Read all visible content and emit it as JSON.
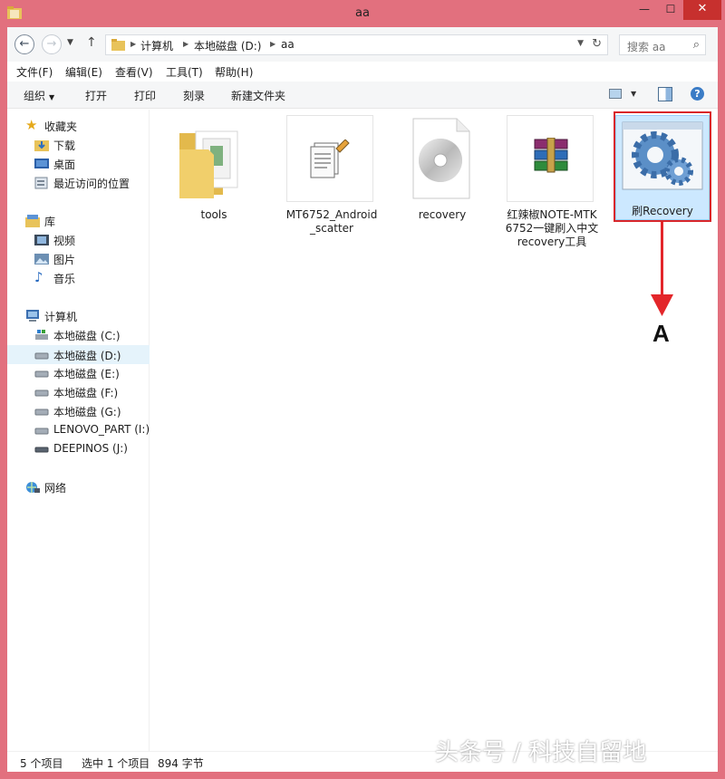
{
  "window": {
    "title": "aa",
    "close_glyph": "✕",
    "min_glyph": "—",
    "max_glyph": "☐"
  },
  "nav": {
    "back_glyph": "←",
    "forward_glyph": "→",
    "up_glyph": "↑",
    "breadcrumbs": [
      "计算机",
      "本地磁盘 (D:)",
      "aa"
    ],
    "search_placeholder": "搜索 aa"
  },
  "menu": [
    "文件(F)",
    "编辑(E)",
    "查看(V)",
    "工具(T)",
    "帮助(H)"
  ],
  "toolbar": {
    "organize": "组织",
    "open": "打开",
    "print": "打印",
    "burn": "刻录",
    "new_folder": "新建文件夹"
  },
  "sidebar": {
    "favorites": {
      "label": "收藏夹",
      "items": [
        "下载",
        "桌面",
        "最近访问的位置"
      ]
    },
    "libraries": {
      "label": "库",
      "items": [
        "视频",
        "图片",
        "音乐"
      ]
    },
    "computer": {
      "label": "计算机",
      "items": [
        "本地磁盘 (C:)",
        "本地磁盘 (D:)",
        "本地磁盘 (E:)",
        "本地磁盘 (F:)",
        "本地磁盘 (G:)",
        "LENOVO_PART (I:)",
        "DEEPINOS (J:)"
      ]
    },
    "network": {
      "label": "网络"
    }
  },
  "files": [
    {
      "name": "tools",
      "icon": "folder-icon"
    },
    {
      "name": "MT6752_Android_scatter",
      "icon": "text-document-icon"
    },
    {
      "name": "recovery",
      "icon": "disc-image-icon"
    },
    {
      "name": "红辣椒NOTE-MTK6752一键刷入中文recovery工具",
      "icon": "winrar-archive-icon"
    },
    {
      "name": "刷Recovery",
      "icon": "gears-batch-icon",
      "selected": true
    }
  ],
  "annotation": {
    "letter": "A",
    "color": "#d8262a"
  },
  "status": {
    "count": "5 个项目",
    "selection": "选中 1 个项目",
    "size": "894 字节"
  },
  "watermark": "头条号 / 科技自留地",
  "colors": {
    "frame": "#e2707e",
    "close": "#c7302e",
    "selection": "#cce8ff"
  }
}
